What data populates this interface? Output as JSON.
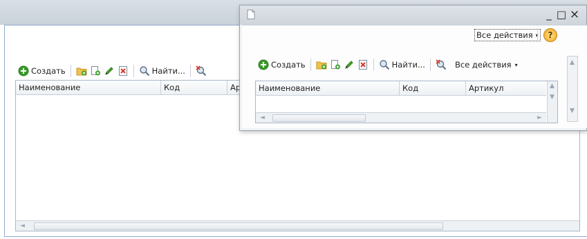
{
  "toolbar": {
    "create_label": "Создать",
    "find_label": "Найти...",
    "all_actions_label": "Все действия"
  },
  "columns": {
    "name": "Наименование",
    "code": "Код",
    "article": "Артикул",
    "article_cut": "Ар"
  },
  "dialog": {
    "all_actions_label": "Все действия",
    "help_symbol": "?",
    "minimize_symbol": "_",
    "maximize_symbol": "□",
    "close_symbol": "×"
  },
  "icons": {
    "create": "plus-circle-icon",
    "add_folder": "add-folder-icon",
    "copy": "copy-icon",
    "edit": "pencil-icon",
    "delete": "delete-icon",
    "find": "magnifier-icon",
    "cancel_find": "cancel-search-icon"
  },
  "colors": {
    "frame_border": "#8fa8c8",
    "create_green": "#3a9b2a",
    "delete_red": "#d43a2a",
    "help_orange": "#f0a020"
  }
}
